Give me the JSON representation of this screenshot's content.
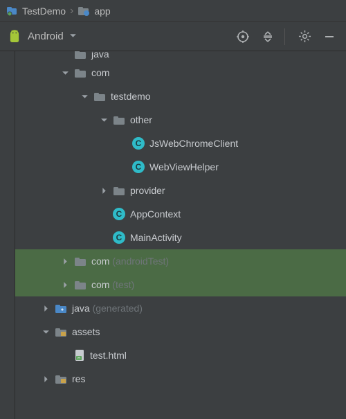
{
  "breadcrumb": {
    "project": "TestDemo",
    "module": "app"
  },
  "toolbar": {
    "view_label": "Android"
  },
  "tree": {
    "nodes": [
      {
        "indent": 2,
        "arrow": "none",
        "icon": "folder",
        "label": "java",
        "dim": "",
        "hl": false,
        "partial": true
      },
      {
        "indent": 2,
        "arrow": "down",
        "icon": "folder",
        "label": "com",
        "dim": "",
        "hl": false
      },
      {
        "indent": 3,
        "arrow": "down",
        "icon": "folder",
        "label": "testdemo",
        "dim": "",
        "hl": false
      },
      {
        "indent": 4,
        "arrow": "down",
        "icon": "folder",
        "label": "other",
        "dim": "",
        "hl": false
      },
      {
        "indent": 5,
        "arrow": "none",
        "icon": "class",
        "label": "JsWebChromeClient",
        "dim": "",
        "hl": false
      },
      {
        "indent": 5,
        "arrow": "none",
        "icon": "class",
        "label": "WebViewHelper",
        "dim": "",
        "hl": false
      },
      {
        "indent": 4,
        "arrow": "right",
        "icon": "folder",
        "label": "provider",
        "dim": "",
        "hl": false
      },
      {
        "indent": 4,
        "arrow": "none",
        "icon": "class",
        "label": "AppContext",
        "dim": "",
        "hl": false
      },
      {
        "indent": 4,
        "arrow": "none",
        "icon": "class",
        "label": "MainActivity",
        "dim": "",
        "hl": false
      },
      {
        "indent": 2,
        "arrow": "right",
        "icon": "folder",
        "label": "com",
        "dim": "(androidTest)",
        "hl": true
      },
      {
        "indent": 2,
        "arrow": "right",
        "icon": "folder",
        "label": "com",
        "dim": "(test)",
        "hl": true
      },
      {
        "indent": 1,
        "arrow": "right",
        "icon": "folder-gen",
        "label": "java",
        "dim": "(generated)",
        "hl": false
      },
      {
        "indent": 1,
        "arrow": "down",
        "icon": "folder-res",
        "label": "assets",
        "dim": "",
        "hl": false
      },
      {
        "indent": 2,
        "arrow": "none",
        "icon": "html-file",
        "label": "test.html",
        "dim": "",
        "hl": false
      },
      {
        "indent": 1,
        "arrow": "right",
        "icon": "folder-res",
        "label": "res",
        "dim": "",
        "hl": false
      }
    ]
  }
}
